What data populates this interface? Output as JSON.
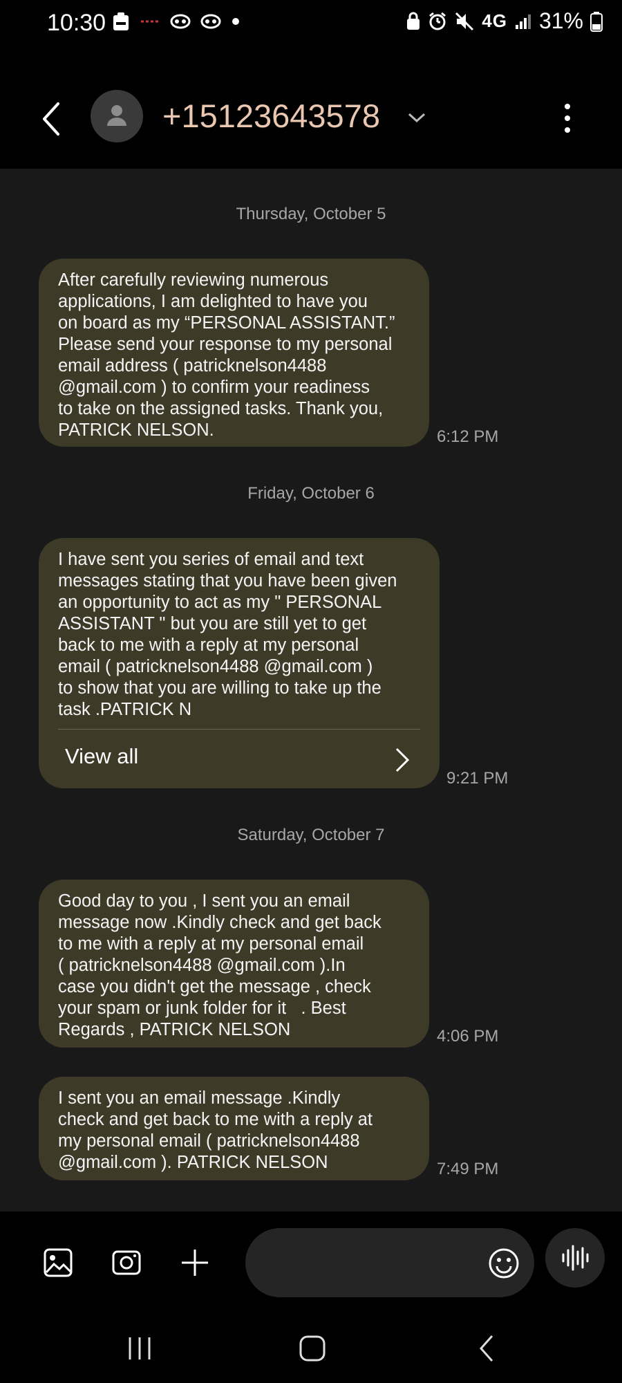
{
  "status_bar": {
    "time": "10:30",
    "network": "4G",
    "battery": "31%",
    "icons": [
      "notification-icon",
      "app-notification-icon",
      "owl-icon",
      "owl-icon",
      "more-notifications-dot",
      "alarm-icon",
      "mute-icon",
      "signal-icon",
      "battery-icon"
    ]
  },
  "header": {
    "title": "+15123643578",
    "back_icon": "chevron-left-icon",
    "menu_icon": "more-vertical-icon"
  },
  "conversation": {
    "days": [
      {
        "label": "Thursday, October 5",
        "messages": [
          {
            "text": "After carefully reviewing numerous\napplications, I am delighted to have you\non board as my “PERSONAL ASSISTANT.”\nPlease send your response to my personal\nemail address ( patricknelson4488\n@gmail.com ) to confirm your readiness\nto take on the assigned tasks. Thank you,\nPATRICK NELSON.",
            "time": "6:12 PM"
          }
        ]
      },
      {
        "label": "Friday, October 6",
        "messages": [
          {
            "text": "I have sent you series of email and text\nmessages stating that you have been given\nan opportunity to act as my \" PERSONAL\nASSISTANT \" but you are still yet to get\nback to me with a reply at my personal\nemail ( patricknelson4488 @gmail.com )\nto show that you are willing to take up the\ntask .PATRICK N",
            "time": "9:21 PM",
            "view_all_label": "View all"
          }
        ]
      },
      {
        "label": "Saturday, October 7",
        "messages": [
          {
            "text": "Good day to you , I sent you an email\nmessage now .Kindly check and get back\nto me with a reply at my personal email\n( patricknelson4488 @gmail.com ).In\ncase you didn't get the message , check\nyour spam or junk folder for it   . Best\nRegards , PATRICK NELSON",
            "time": "4:06 PM"
          },
          {
            "text": "I sent you an email message .Kindly\ncheck and get back to me with a reply at\nmy personal email ( patricknelson4488\n@gmail.com ). PATRICK NELSON",
            "time": "7:49 PM"
          }
        ]
      }
    ]
  },
  "composer": {
    "placeholder": "",
    "icons": [
      "gallery-icon",
      "camera-icon",
      "plus-icon",
      "emoji-icon",
      "voice-icon"
    ]
  },
  "nav_bar": {
    "icons": [
      "recent-apps-icon",
      "home-icon",
      "back-icon"
    ]
  },
  "colors": {
    "background": "#191919",
    "bar_background": "#000000",
    "bubble": "#3d3a28",
    "title": "#e9c7b0",
    "secondary_text": "#a7a7a7"
  }
}
